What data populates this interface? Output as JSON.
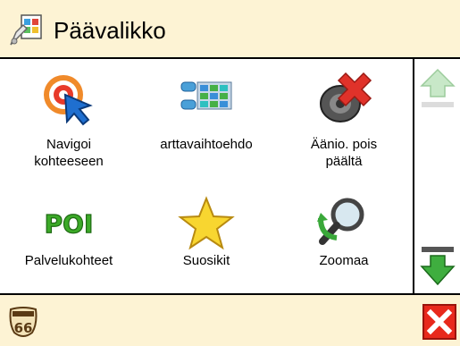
{
  "header": {
    "title": "Päävalikko",
    "icon": "menu-app-icon"
  },
  "menu": {
    "items": [
      {
        "label": "Navigoi\nkohteeseen",
        "icon": "navigate-target-icon"
      },
      {
        "label": "arttavaihtoehdo",
        "icon": "map-options-icon"
      },
      {
        "label": "Äänio. pois\npäältä",
        "icon": "sound-off-icon"
      },
      {
        "label": "Palvelukohteet",
        "icon": "poi-icon"
      },
      {
        "label": "Suosikit",
        "icon": "star-icon"
      },
      {
        "label": "Zoomaa",
        "icon": "zoom-icon"
      }
    ]
  },
  "scrollbar": {
    "up": "scroll-up-arrow-icon",
    "down": "scroll-down-arrow-icon"
  },
  "footer": {
    "left_icon": "route-66-icon",
    "right_icon": "close-icon"
  },
  "colors": {
    "bar_bg": "#fdf3d4",
    "close_red": "#e8291c",
    "arrow_green": "#3fae3f"
  }
}
